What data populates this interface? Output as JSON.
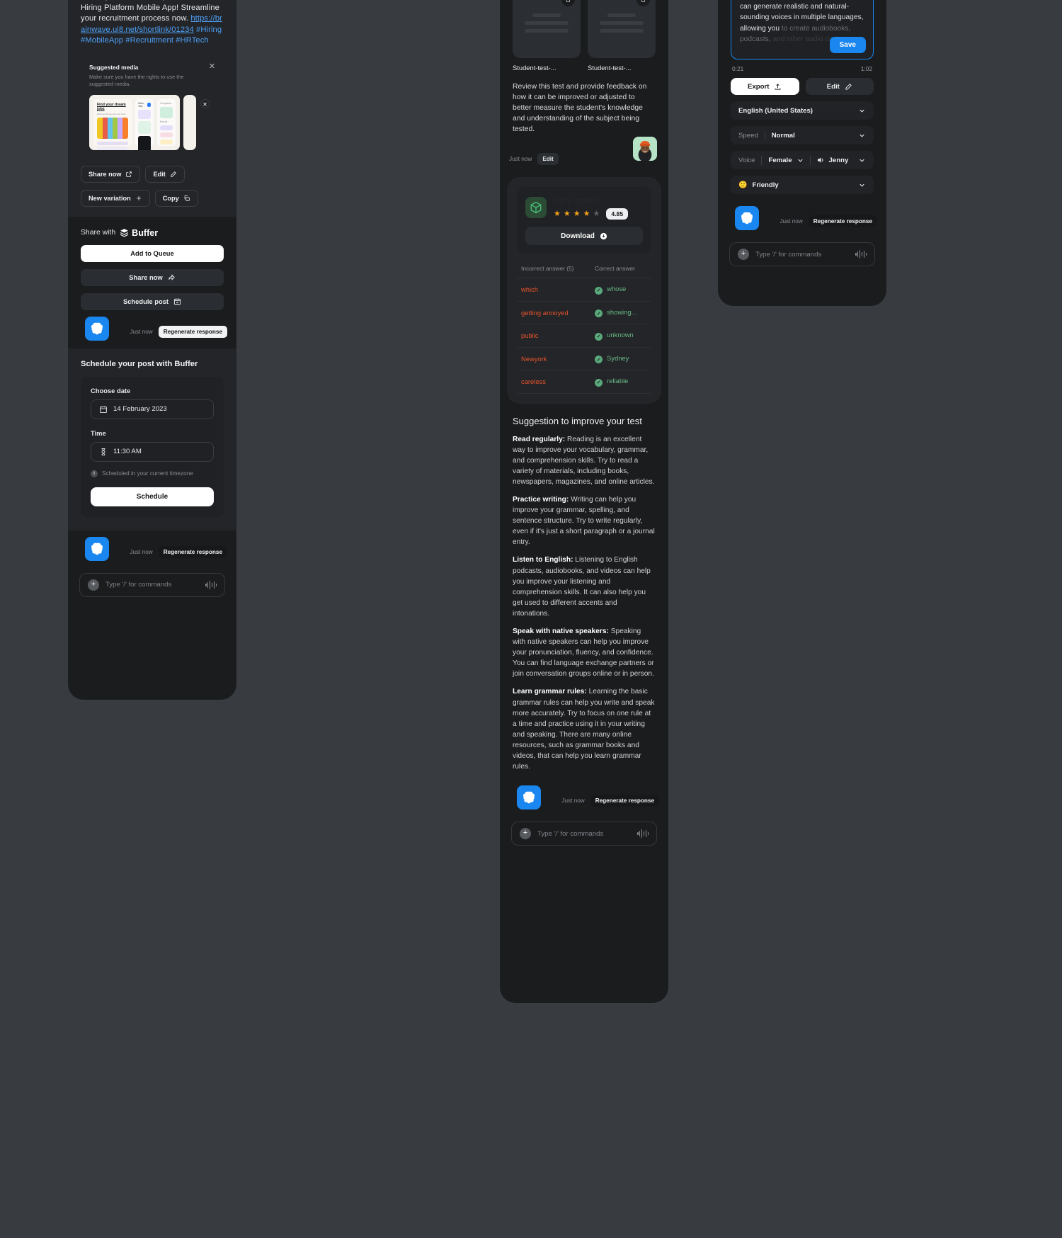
{
  "canvas": {
    "background": "#383c40"
  },
  "accent": {
    "blue": "#1a86f0",
    "orange": "#e8532c",
    "green": "#69b987",
    "star": "#f2a21c"
  },
  "buffer_panel": {
    "post_text_lead": "Find top talent in a snap with our new Hiring Platform Mobile App! Streamline your recruitment process now. ",
    "post_link": "https://brainwave.ui8.net/shortlink/01234",
    "post_tags": " #Hiring #MobileApp #Recruitment #HRTech",
    "suggested_media": {
      "title": "Suggested media",
      "subtitle": "Make sure you have the rights to use the suggested media.",
      "close_icon": "close-icon",
      "thumb_title": "Find your dream jobs",
      "thumb_sub": "Discover 10 top jobs and more",
      "thumb_b_hdr": "Hello, Tam",
      "thumb_c_lbl": "Companies",
      "thumb_c_lbl2": "Recruit"
    },
    "actions": [
      {
        "label": "Share now",
        "icon": "external-link-icon"
      },
      {
        "label": "Edit",
        "icon": "pencil-icon"
      },
      {
        "label": "New variation",
        "icon": "plus-icon"
      },
      {
        "label": "Copy",
        "icon": "copy-icon"
      }
    ],
    "share_with_label": "Share with",
    "share_with_brand": "Buffer",
    "buffer_actions": [
      {
        "label": "Add to Queue",
        "style": "white",
        "icon": ""
      },
      {
        "label": "Share now",
        "style": "dark",
        "icon": "share-arrow-icon"
      },
      {
        "label": "Schedule post",
        "style": "dark",
        "icon": "calendar-check-icon"
      }
    ],
    "ai_meta": {
      "time": "Just now",
      "regenerate": "Regenerate response"
    },
    "schedule_card": {
      "title": "Schedule your post with Buffer",
      "date_label": "Choose date",
      "date_value": "14 February 2023",
      "date_icon": "calendar-icon",
      "time_label": "Time",
      "time_value": "11:30 AM",
      "time_icon": "hourglass-icon",
      "timezone_note": "Scheduled in your current timezone",
      "info_icon": "info-icon",
      "submit_label": "Schedule"
    },
    "ai_meta2": {
      "time": "Just now",
      "regenerate": "Regenerate response"
    },
    "composer": {
      "placeholder": "Type '/' for commands",
      "plus_icon": "plus-circle-icon",
      "wave_icon": "waveform-icon"
    }
  },
  "test_panel": {
    "files": [
      {
        "name": "Student-test-...",
        "delete_icon": "trash-icon"
      },
      {
        "name": "Student-test-...",
        "delete_icon": "trash-icon"
      }
    ],
    "review_text": "Review this test and provide feedback on how it can be improved or adjusted to better measure the student's knowledge and understanding of the subject being tested.",
    "user_meta": {
      "time": "Just now",
      "edit": "Edit",
      "avatar": "user-avatar"
    },
    "result": {
      "badge_icon": "cube-icon",
      "title": "Very good!",
      "stars_filled": 4,
      "stars_total": 5,
      "score": "4.85",
      "download_label": "Download",
      "download_icon": "download-icon",
      "table": {
        "headers": [
          "Incorrect answer (5)",
          "Correct answer"
        ],
        "rows": [
          {
            "wrong": "which",
            "correct": "whose"
          },
          {
            "wrong": "getting annoyed",
            "correct": "showing..."
          },
          {
            "wrong": "public",
            "correct": "unknown"
          },
          {
            "wrong": "Newyork",
            "correct": "Sydney"
          },
          {
            "wrong": "careless",
            "correct": "reliable"
          }
        ]
      }
    },
    "suggestion_heading": "Suggestion to improve your test",
    "suggestions": [
      {
        "term": "Read regularly:",
        "body": " Reading is an excellent way to improve your vocabulary, grammar, and comprehension skills. Try to read a variety of materials, including books, newspapers, magazines, and online articles."
      },
      {
        "term": "Practice writing:",
        "body": " Writing can help you improve your grammar, spelling, and sentence structure. Try to write regularly, even if it's just a short paragraph or a journal entry."
      },
      {
        "term": "Listen to English:",
        "body": " Listening to English podcasts, audiobooks, and videos can help you improve your listening and comprehension skills. It can also help you get used to different accents and intonations."
      },
      {
        "term": "Speak with native speakers:",
        "body": " Speaking with native speakers can help you improve your pronunciation, fluency, and confidence. You can find language exchange partners or join conversation groups online or in person."
      },
      {
        "term": "Learn grammar rules:",
        "body": " Learning the basic grammar rules can help you write and speak more accurately. Try to focus on one rule at a time and practice using it in your writing and speaking. There are many online resources, such as grammar books and videos, that can help you learn grammar rules."
      }
    ],
    "ai_meta": {
      "time": "Just now",
      "regenerate": "Regenerate response"
    },
    "composer": {
      "placeholder": "Type '/' for commands",
      "plus_icon": "plus-circle-icon",
      "wave_icon": "waveform-icon"
    }
  },
  "speech_panel": {
    "text_visible": "text-to-speech technology, Speechify can generate realistic and natural-sounding voices in multiple languages, allowing you ",
    "text_fade": "to create audiobooks, podcasts, ",
    "text_fade2": "and other audio content",
    "save_label": "Save",
    "time_current": "0:21",
    "time_total": "1:02",
    "buttons": [
      {
        "label": "Export",
        "icon": "upload-icon",
        "style": "white"
      },
      {
        "label": "Edit",
        "icon": "pencil-icon",
        "style": "dark"
      }
    ],
    "language": {
      "value": "English (United States)",
      "chevron": "chevron-down-icon"
    },
    "speed": {
      "label": "Speed",
      "value": "Normal",
      "chevron": "chevron-down-icon"
    },
    "voice": {
      "label": "Voice",
      "gender": "Female",
      "name": "Jenny",
      "speaker_icon": "speaker-icon",
      "chevron": "chevron-down-icon"
    },
    "tone": {
      "emoji": "🙂",
      "value": "Friendly",
      "chevron": "chevron-down-icon"
    },
    "ai_meta": {
      "time": "Just now",
      "regenerate": "Regenerate response"
    },
    "composer": {
      "placeholder": "Type '/' for commands",
      "plus_icon": "plus-circle-icon",
      "wave_icon": "waveform-icon"
    }
  }
}
